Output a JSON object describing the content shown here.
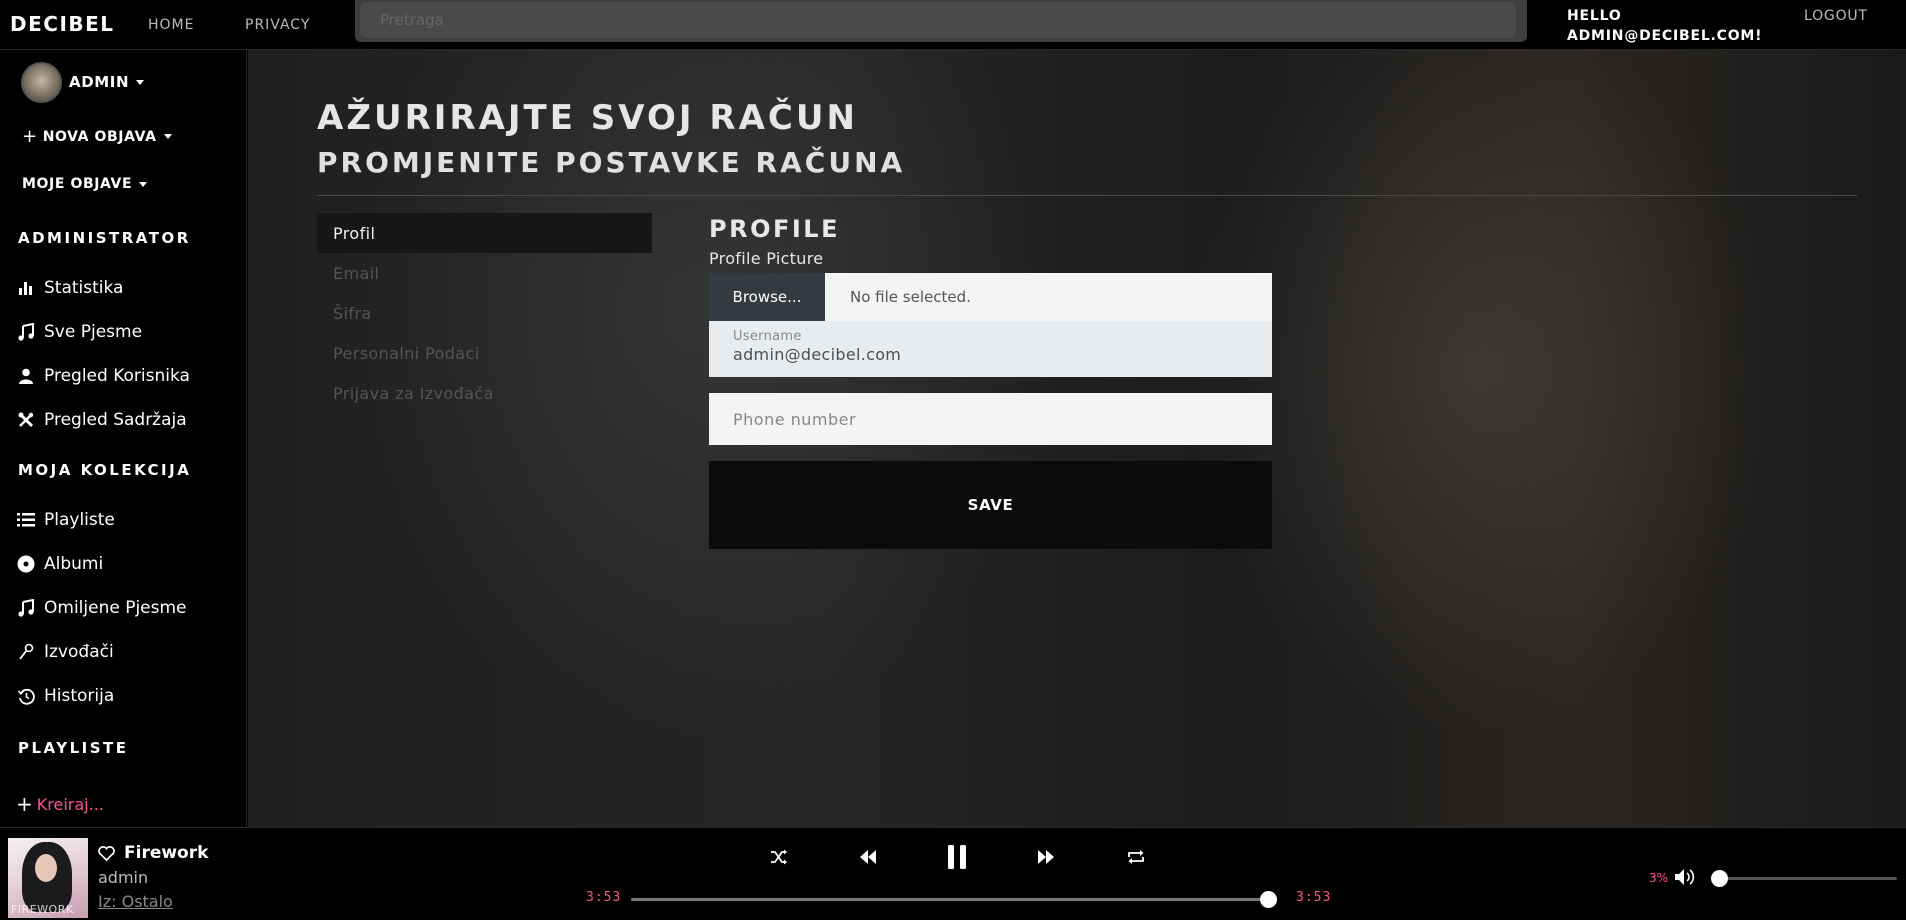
{
  "header": {
    "brand": "DECIBEL",
    "nav": [
      "HOME",
      "PRIVACY"
    ],
    "search_placeholder": "Pretraga",
    "greeting_line1": "HELLO",
    "greeting_line2": "ADMIN@DECIBEL.COM!",
    "logout": "LOGOUT"
  },
  "sidebar": {
    "user": "ADMIN",
    "new_post": "NOVA OBJAVA",
    "my_posts": "MOJE OBJAVE",
    "admin_title": "ADMINISTRATOR",
    "admin_items": [
      {
        "label": "Statistika",
        "icon": "bar-chart-icon"
      },
      {
        "label": "Sve Pjesme",
        "icon": "music-note-icon"
      },
      {
        "label": "Pregled Korisnika",
        "icon": "person-icon"
      },
      {
        "label": "Pregled Sadržaja",
        "icon": "tools-icon"
      }
    ],
    "collection_title": "MOJA KOLEKCIJA",
    "collection_items": [
      {
        "label": "Playliste",
        "icon": "list-icon"
      },
      {
        "label": "Albumi",
        "icon": "disc-icon"
      },
      {
        "label": "Omiljene Pjesme",
        "icon": "music-note-icon"
      },
      {
        "label": "Izvođači",
        "icon": "microphone-icon"
      },
      {
        "label": "Historija",
        "icon": "history-icon"
      }
    ],
    "playlists_title": "PLAYLISTE",
    "create": "Kreiraj..."
  },
  "main": {
    "title": "AŽURIRAJTE SVOJ RAČUN",
    "subtitle": "PROMJENITE POSTAVKE RAČUNA",
    "subnav": [
      "Profil",
      "Email",
      "Šifra",
      "Personalni Podaci",
      "Prijava za Izvođača"
    ],
    "active_subnav": "Profil",
    "panel_title": "PROFILE",
    "picture_label": "Profile Picture",
    "browse_label": "Browse...",
    "file_status": "No file selected.",
    "username_label": "Username",
    "username_value": "admin@decibel.com",
    "phone_placeholder": "Phone number",
    "save_label": "SAVE"
  },
  "player": {
    "title": "Firework",
    "artist": "admin",
    "album": "Iz: Ostalo",
    "cover_text": "FIREWORK",
    "elapsed": "3:53",
    "duration": "3:53",
    "progress": 1.0,
    "volume_label": "3%",
    "volume": 0.03,
    "accent_color": "#ff4f9a"
  }
}
